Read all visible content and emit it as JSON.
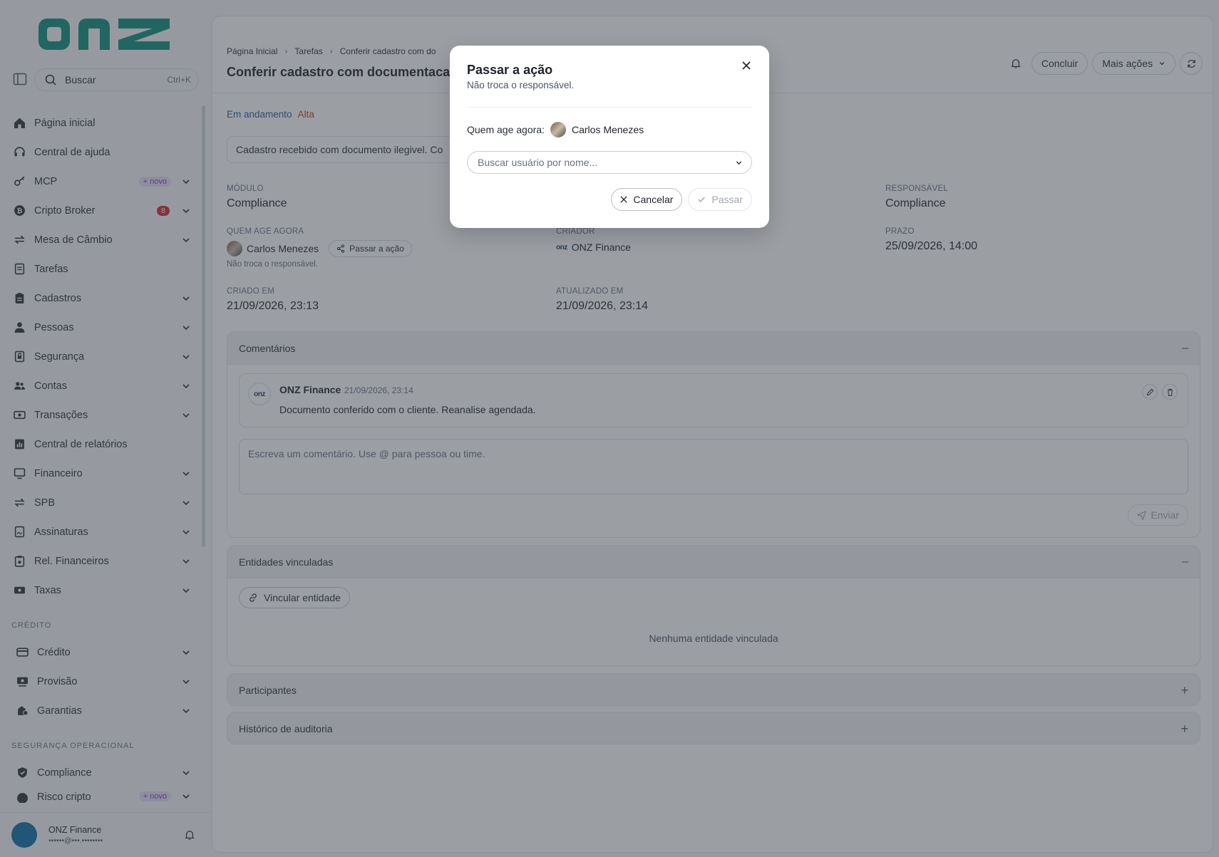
{
  "sidebar": {
    "search_label": "Buscar",
    "search_shortcut": "Ctrl+K",
    "items": [
      {
        "label": "Página inicial",
        "icon": "home-icon"
      },
      {
        "label": "Central de ajuda",
        "icon": "headset-icon"
      },
      {
        "label": "MCP",
        "icon": "key-icon",
        "badge": "+ novo"
      },
      {
        "label": "Cripto Broker",
        "icon": "bitcoin-icon",
        "count": "8"
      },
      {
        "label": "Mesa de Câmbio",
        "icon": "exchange-icon"
      },
      {
        "label": "Tarefas",
        "icon": "task-icon"
      },
      {
        "label": "Cadastros",
        "icon": "clipboard-icon"
      },
      {
        "label": "Pessoas",
        "icon": "person-icon"
      },
      {
        "label": "Segurança",
        "icon": "lock-doc-icon"
      },
      {
        "label": "Contas",
        "icon": "users-icon"
      },
      {
        "label": "Transações",
        "icon": "money-icon"
      },
      {
        "label": "Central de relatórios",
        "icon": "report-icon"
      },
      {
        "label": "Financeiro",
        "icon": "monitor-icon"
      },
      {
        "label": "SPB",
        "icon": "exchange-icon"
      },
      {
        "label": "Assinaturas",
        "icon": "signature-icon"
      },
      {
        "label": "Rel. Financeiros",
        "icon": "finance-report-icon"
      },
      {
        "label": "Taxas",
        "icon": "taxes-icon"
      }
    ],
    "section_credito": "CRÉDITO",
    "credito_items": [
      {
        "label": "Crédito",
        "icon": "card-icon"
      },
      {
        "label": "Provisão",
        "icon": "provision-icon"
      },
      {
        "label": "Garantias",
        "icon": "guarantee-icon"
      }
    ],
    "section_seg": "SEGURANÇA OPERACIONAL",
    "seg_items": [
      {
        "label": "Compliance",
        "icon": "shield-icon"
      },
      {
        "label": "Risco cripto",
        "icon": "risk-icon",
        "badge": "+ novo"
      }
    ],
    "user": {
      "name": "ONZ Finance",
      "email": "••••••@•••.••••••••"
    }
  },
  "header": {
    "breadcrumb": [
      "Página Inicial",
      "Tarefas",
      "Conferir cadastro com do"
    ],
    "title": "Conferir cadastro com documentacao il",
    "btn_concluir": "Concluir",
    "btn_mais": "Mais ações"
  },
  "task": {
    "status": "Em andamento",
    "priority": "Alta",
    "description": "Cadastro recebido com documento ilegivel. Co",
    "modulo_label": "MÓDULO",
    "modulo_value": "Compliance",
    "responsavel_label": "RESPONSÁVEL",
    "responsavel_value": "Compliance",
    "quem_label": "QUEM AGE AGORA",
    "quem_value": "Carlos Menezes",
    "passar_chip": "Passar a ação",
    "nao_troca": "Não troca o responsável.",
    "criador_label": "CRIADOR",
    "criador_value": "ONZ Finance",
    "prazo_label": "PRAZO",
    "prazo_value": "25/09/2026, 14:00",
    "criado_label": "CRIADO EM",
    "criado_value": "21/09/2026, 23:13",
    "atualizado_label": "ATUALIZADO EM",
    "atualizado_value": "21/09/2026, 23:14"
  },
  "comments": {
    "title": "Comentários",
    "author": "ONZ Finance",
    "time": "21/09/2026, 23:14",
    "text": "Documento conferido com o cliente. Reanalise agendada.",
    "placeholder": "Escreva um comentário. Use @ para pessoa ou time.",
    "send": "Enviar"
  },
  "entities": {
    "title": "Entidades vinculadas",
    "link_btn": "Vincular entidade",
    "empty": "Nenhuma entidade vinculada"
  },
  "participants": {
    "title": "Participantes"
  },
  "audit": {
    "title": "Histórico de auditoria"
  },
  "modal": {
    "title": "Passar a ação",
    "subtitle": "Não troca o responsável.",
    "who_label": "Quem age agora:",
    "who_name": "Carlos Menezes",
    "select_placeholder": "Buscar usuário por nome...",
    "cancel": "Cancelar",
    "pass": "Passar"
  },
  "colors": {
    "brand": "#0c8f7a",
    "accent_status": "#1f5fa8",
    "priority_high": "#c2411a"
  }
}
